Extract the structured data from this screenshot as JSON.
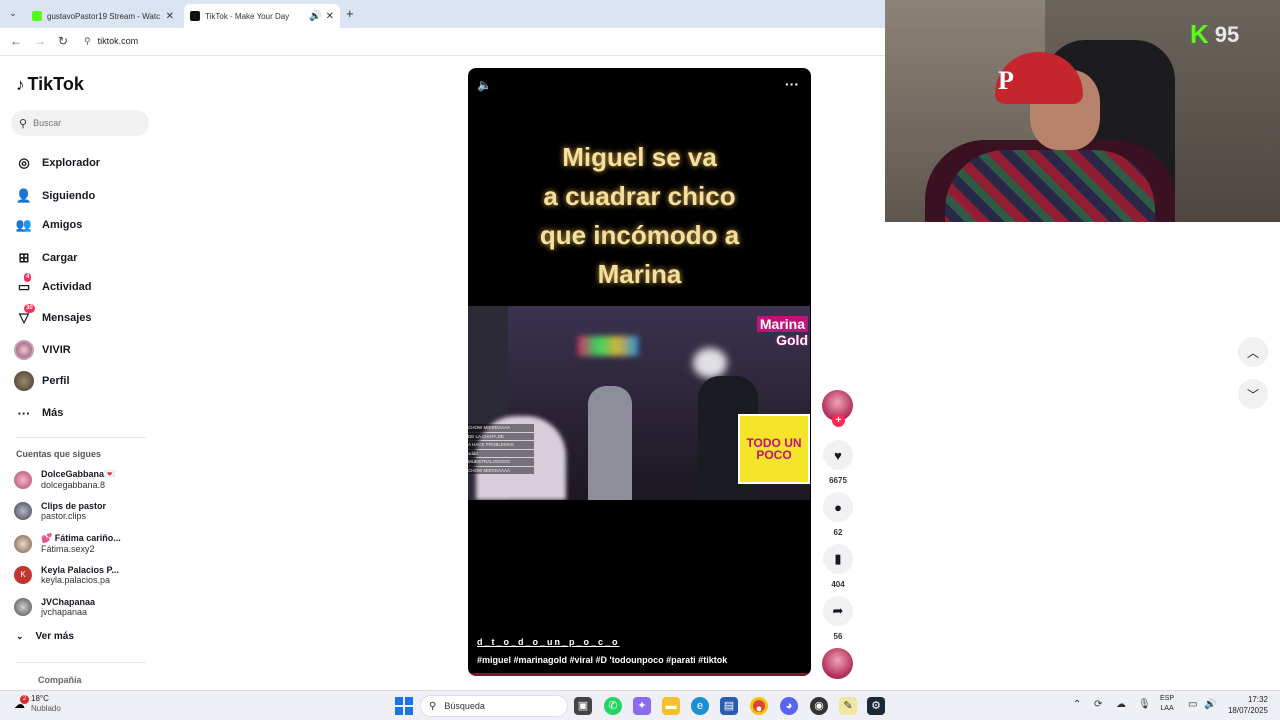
{
  "browser": {
    "tabs": [
      {
        "title": "gustavoPastor19 Stream - Watc",
        "favicon_color": "#53fc18"
      },
      {
        "title": "TikTok - Make Your Day",
        "favicon_color": "#111111"
      }
    ],
    "url": "tiktok.com"
  },
  "sidebar": {
    "logo": "TikTok",
    "search_placeholder": "Buscar",
    "items": [
      {
        "label": "Explorador",
        "icon": "compass-icon"
      },
      {
        "label": "Siguiendo",
        "icon": "following-icon"
      },
      {
        "label": "Amigos",
        "icon": "friends-icon"
      },
      {
        "label": "Cargar",
        "icon": "upload-icon"
      },
      {
        "label": "Actividad",
        "icon": "activity-icon",
        "badge": "4"
      },
      {
        "label": "Mensajes",
        "icon": "messages-icon",
        "badge": "30"
      },
      {
        "label": "VIVIR",
        "icon": "live-avatar"
      },
      {
        "label": "Perfil",
        "icon": "profile-avatar"
      },
      {
        "label": "Más",
        "icon": "more-icon"
      }
    ],
    "following_title": "Cuentas que sigues",
    "following": [
      {
        "name": "DolceGabbana💌",
        "handle": "dolcegabbana.8"
      },
      {
        "name": "Clips de pastor",
        "handle": "pastor.clips"
      },
      {
        "name": "💕 Fátima cariño...",
        "handle": "Fátima.sexy2"
      },
      {
        "name": "Keyla Palacios P...",
        "handle": "keyla.palacios.pa"
      },
      {
        "name": "JVChapanaa",
        "handle": "jvchapanaa"
      }
    ],
    "see_more": "Ver más",
    "company": "Compañía"
  },
  "video": {
    "caption_lines": [
      "Miguel se va",
      "a cuadrar chico",
      "que incómodo a",
      "Marina"
    ],
    "overlay_brand_1": "Marina",
    "overlay_brand_2": "Gold",
    "overlay_sticker": "TODO UN POCO",
    "chat_lines": [
      "CHOW MIERDAAAA",
      "DE LA CHATA DE",
      "A HACE PROBLEMAS",
      "xddd",
      "MUESTRALOOOOO",
      "CHOW MIERDAAAA"
    ],
    "author": "d_t_o_d_o_un_p_o_c_o",
    "hashtags": "#miguel  #marinagold  #viral  #D 'todounpoco #parati  #tiktok"
  },
  "actions": {
    "likes": "6675",
    "comments": "62",
    "saves": "404",
    "shares": "56"
  },
  "stream_overlay": {
    "viewers": "95"
  },
  "taskbar": {
    "temp": "18°C",
    "weather": "Nublado",
    "weather_badge": "2",
    "search_label": "Búsqueda",
    "lang_1": "ESP",
    "lang_2": "LAA",
    "time": "17:32",
    "date": "18/07/2025"
  }
}
